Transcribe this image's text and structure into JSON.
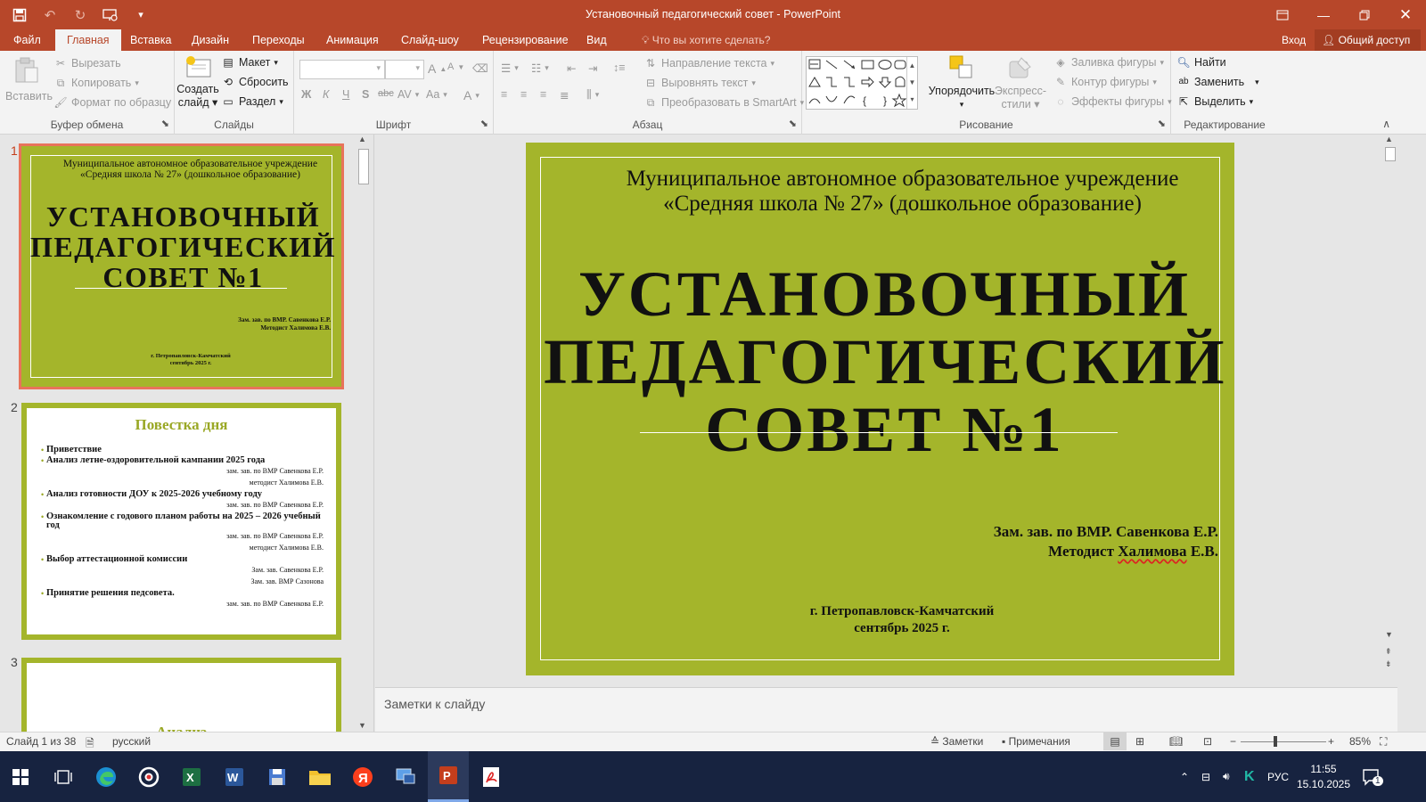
{
  "window": {
    "title": "Установочный педагогический совет - PowerPoint"
  },
  "tabs": [
    {
      "label": "Файл"
    },
    {
      "label": "Главная"
    },
    {
      "label": "Вставка"
    },
    {
      "label": "Дизайн"
    },
    {
      "label": "Переходы"
    },
    {
      "label": "Анимация"
    },
    {
      "label": "Слайд-шоу"
    },
    {
      "label": "Рецензирование"
    },
    {
      "label": "Вид"
    }
  ],
  "tell_me": "Что вы хотите сделать?",
  "sign_in": "Вход",
  "share": "Общий доступ",
  "ribbon": {
    "clipboard": {
      "label": "Буфер обмена",
      "paste": "Вставить",
      "cut": "Вырезать",
      "copy": "Копировать",
      "format_painter": "Формат по образцу"
    },
    "slides": {
      "label": "Слайды",
      "new_slide_1": "Создать",
      "new_slide_2": "слайд",
      "layout": "Макет",
      "reset": "Сбросить",
      "section": "Раздел"
    },
    "font": {
      "label": "Шрифт",
      "bold": "Ж",
      "italic": "К",
      "underline": "Ч",
      "shadow": "S",
      "strike": "abc",
      "spacing": "AV",
      "case": "Aa",
      "color": "A",
      "grow": "A",
      "shrink": "A"
    },
    "paragraph": {
      "label": "Абзац",
      "text_direction": "Направление текста",
      "align_text": "Выровнять текст",
      "smartart": "Преобразовать в SmartArt"
    },
    "drawing": {
      "label": "Рисование",
      "arrange": "Упорядочить",
      "quick_styles_1": "Экспресс-",
      "quick_styles_2": "стили",
      "fill": "Заливка фигуры",
      "outline": "Контур фигуры",
      "effects": "Эффекты фигуры"
    },
    "editing": {
      "label": "Редактирование",
      "find": "Найти",
      "replace": "Заменить",
      "select": "Выделить"
    }
  },
  "thumbnails": {
    "numbers": [
      "1",
      "2",
      "3"
    ],
    "slide1": {
      "org_line1": "Муниципальное автономное образовательное учреждение",
      "org_line2": "«Средняя школа № 27» (дошкольное образование)",
      "title1": "УСТАНОВОЧНЫЙ",
      "title2": "ПЕДАГОГИЧЕСКИЙ",
      "title3": "СОВЕТ №1",
      "author1": "Зам. зав. по ВМР. Савенкова Е.Р.",
      "author2": "Методист Халимова Е.В.",
      "city": "г. Петропавловск-Камчатский",
      "date": "сентябрь 2025 г."
    },
    "slide2": {
      "title": "Повестка дня",
      "items": [
        {
          "text": "Приветствие",
          "notes": []
        },
        {
          "text": "Анализ летне-оздоровительной кампании 2025 года",
          "notes": [
            "зам. зав. по ВМР Савенкова Е.Р.",
            "методист Халимова Е.В."
          ]
        },
        {
          "text": "Анализ готовности ДОУ к 2025-2026 учебному году",
          "notes": [
            "зам. зав. по ВМР Савенкова Е.Р."
          ]
        },
        {
          "text": "Ознакомление с  годового планом работы  на 2025 – 2026 учебный год",
          "notes": [
            "зам. зав. по ВМР Савенкова Е.Р.",
            "методист Халимова Е.В."
          ]
        },
        {
          "text": "Выбор аттестационной комиссии",
          "notes": [
            "Зам. зав. Савенкова Е.Р.",
            "Зам. зав. ВМР Сазонова"
          ]
        },
        {
          "text": "Принятие решения педсовета.",
          "notes": [
            "зам. зав. по ВМР Савенкова Е.Р."
          ]
        }
      ]
    },
    "slide3": {
      "partial_title": "Анализ"
    }
  },
  "slide": {
    "org_line1": "Муниципальное автономное образовательное учреждение",
    "org_line2": "«Средняя школа № 27» (дошкольное образование)",
    "title1": "УСТАНОВОЧНЫЙ",
    "title2": "ПЕДАГОГИЧЕСКИЙ",
    "title3": "СОВЕТ №1",
    "author1": "Зам. зав. по ВМР. Савенкова Е.Р.",
    "author2_prefix": "Методист ",
    "author2_name": "Халимова",
    "author2_suffix": " Е.В.",
    "city": "г. Петропавловск-Камчатский",
    "date": "сентябрь 2025 г."
  },
  "notes": {
    "placeholder": "Заметки к слайду"
  },
  "status": {
    "slide_of": "Слайд 1 из 38",
    "language": "русский",
    "notes_btn": "Заметки",
    "comments_btn": "Примечания",
    "zoom": "85%"
  },
  "taskbar": {
    "lang": "РУС",
    "time": "11:55",
    "date": "15.10.2025",
    "notif_count": "1"
  },
  "colors": {
    "accent": "#b7472a",
    "slide_bg": "#a4b52b",
    "selected_outline": "#e8735a"
  }
}
